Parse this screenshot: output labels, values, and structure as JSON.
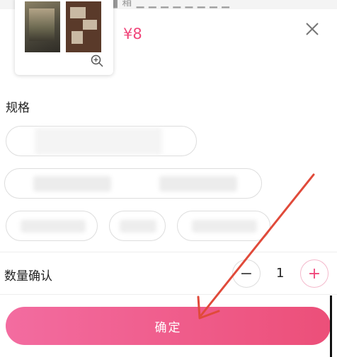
{
  "product": {
    "price": "¥8"
  },
  "specs": {
    "label": "规格"
  },
  "quantity": {
    "label": "数量确认",
    "value": "1",
    "minus": "−",
    "plus": "+"
  },
  "footer": {
    "confirm_label": "确定"
  },
  "colors": {
    "accent": "#f0467a",
    "button_start": "#f36ca0",
    "button_end": "#ec4f79",
    "annotation_arrow": "#e04a3a"
  }
}
